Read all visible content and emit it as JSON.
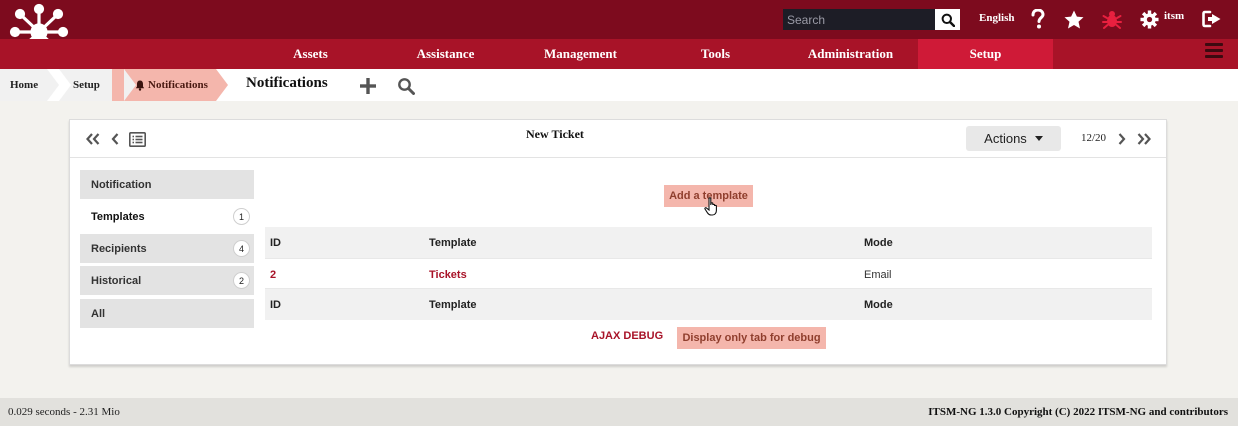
{
  "header": {
    "search_placeholder": "Search",
    "language": "English",
    "username": "itsm"
  },
  "nav": {
    "items": [
      {
        "label": "Assets"
      },
      {
        "label": "Assistance"
      },
      {
        "label": "Management"
      },
      {
        "label": "Tools"
      },
      {
        "label": "Administration"
      },
      {
        "label": "Setup",
        "active": true
      }
    ]
  },
  "breadcrumb": {
    "items": [
      "Home",
      "Setup",
      "Notifications"
    ],
    "page_title": "Notifications"
  },
  "record": {
    "title": "New Ticket",
    "actions_label": "Actions",
    "position": "12/20"
  },
  "tabs": [
    {
      "label": "Notification",
      "count": ""
    },
    {
      "label": "Templates",
      "count": "1",
      "active": true
    },
    {
      "label": "Recipients",
      "count": "4"
    },
    {
      "label": "Historical",
      "count": "2"
    },
    {
      "label": "All",
      "count": ""
    }
  ],
  "templates": {
    "add_label": "Add a template",
    "columns": [
      "ID",
      "Template",
      "Mode"
    ],
    "rows": [
      {
        "id": "2",
        "template": "Tickets",
        "mode": "Email"
      }
    ]
  },
  "debug": {
    "ajax_label": "AJAX DEBUG",
    "button_label": "Display only tab for debug"
  },
  "footer": {
    "timing": "0.029 seconds - 2.31 Mio",
    "copyright": "ITSM-NG 1.3.0 Copyright (C) 2022 ITSM-NG and contributors"
  },
  "colors": {
    "header_bg": "#7d0b1e",
    "nav_bg": "#a81328",
    "nav_active": "#cf1a37",
    "accent_button": "#f4b6ac"
  }
}
